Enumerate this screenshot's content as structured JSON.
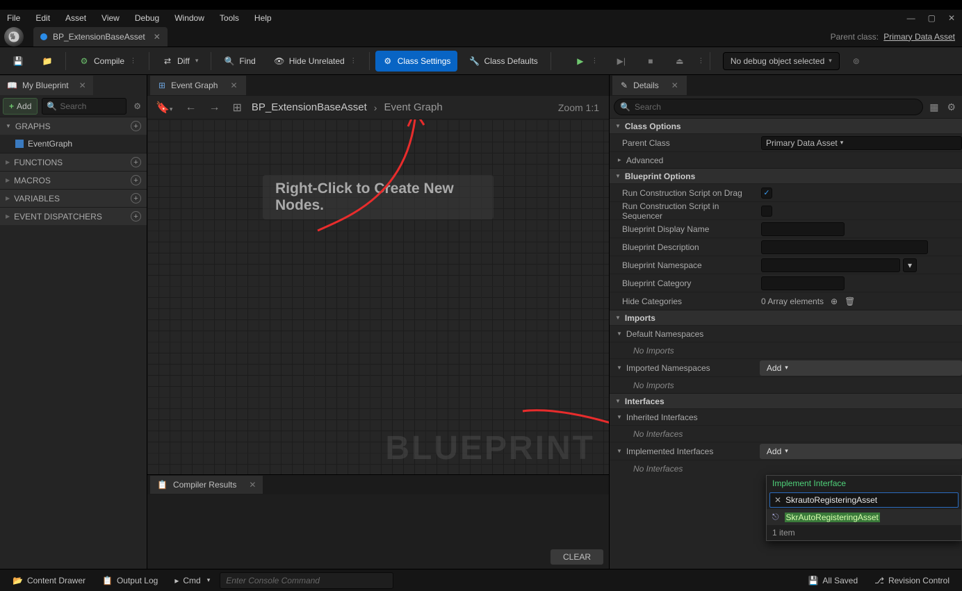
{
  "menu": {
    "file": "File",
    "edit": "Edit",
    "asset": "Asset",
    "view": "View",
    "debug": "Debug",
    "window": "Window",
    "tools": "Tools",
    "help": "Help"
  },
  "mainTab": {
    "label": "BP_ExtensionBaseAsset"
  },
  "parentClass": {
    "label": "Parent class:",
    "link": "Primary Data Asset"
  },
  "toolbar": {
    "compile": "Compile",
    "diff": "Diff",
    "find": "Find",
    "hideUnrelated": "Hide Unrelated",
    "classSettings": "Class Settings",
    "classDefaults": "Class Defaults",
    "debugSelect": "No debug object selected"
  },
  "leftPanel": {
    "title": "My Blueprint",
    "add": "Add",
    "searchPlaceholder": "Search",
    "cats": [
      "GRAPHS",
      "FUNCTIONS",
      "MACROS",
      "VARIABLES",
      "EVENT DISPATCHERS"
    ],
    "eventGraph": "EventGraph"
  },
  "midPanel": {
    "tab": "Event Graph",
    "crumb1": "BP_ExtensionBaseAsset",
    "crumb2": "Event Graph",
    "zoom": "Zoom 1:1",
    "hint": "Right-Click to Create New Nodes.",
    "watermark": "BLUEPRINT"
  },
  "compiler": {
    "tab": "Compiler Results",
    "clear": "CLEAR"
  },
  "details": {
    "tab": "Details",
    "searchPlaceholder": "Search",
    "classOptions": "Class Options",
    "parentClassLabel": "Parent Class",
    "parentClassValue": "Primary Data Asset",
    "advanced": "Advanced",
    "blueprintOptions": "Blueprint Options",
    "runDrag": "Run Construction Script on Drag",
    "runSeq": "Run Construction Script in Sequencer",
    "bpDisplayName": "Blueprint Display Name",
    "bpDescription": "Blueprint Description",
    "bpNamespace": "Blueprint Namespace",
    "bpCategory": "Blueprint Category",
    "hideCategories": "Hide Categories",
    "arrayElements": "0 Array elements",
    "imports": "Imports",
    "defaultNamespaces": "Default Namespaces",
    "noImports": "No Imports",
    "importedNamespaces": "Imported Namespaces",
    "addLabel": "Add",
    "interfaces": "Interfaces",
    "inheritedInterfaces": "Inherited Interfaces",
    "noInterfaces": "No Interfaces",
    "implementedInterfaces": "Implemented Interfaces"
  },
  "ifPopup": {
    "header": "Implement Interface",
    "searchValue": "SkrautoRegisteringAsset",
    "result": "SkrAutoRegisteringAsset",
    "footer": "1 item"
  },
  "status": {
    "contentDrawer": "Content Drawer",
    "outputLog": "Output Log",
    "cmd": "Cmd",
    "cmdPlaceholder": "Enter Console Command",
    "allSaved": "All Saved",
    "revision": "Revision Control"
  }
}
